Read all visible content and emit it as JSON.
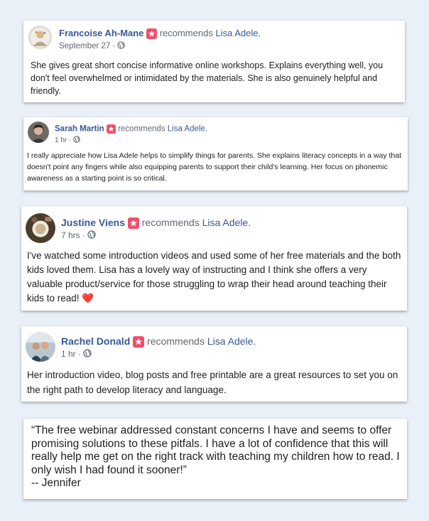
{
  "reviews": [
    {
      "name": "Francoise Ah-Mane",
      "recommends": "recommends",
      "page": "Lisa Adele.",
      "time": "September 27 ·",
      "text": "She gives great short concise informative online workshops. Explains everything well, you don't feel overwhelmed or intimidated by the materials. She is also genuinely helpful and friendly."
    },
    {
      "name": "Sarah Martin",
      "recommends": "recommends",
      "page": "Lisa Adele.",
      "time": "1 hr ·",
      "text": "I really appreciate how Lisa Adele helps to simplify things for parents. She explains literacy concepts in a way that doesn't point any fingers while also equipping parents to support their child's learning. Her focus on phonemic awareness as a starting point is so critical."
    },
    {
      "name": "Justine Viens",
      "recommends": "recommends",
      "page": "Lisa Adele.",
      "time": "7 hrs ·",
      "text": "I've watched some introduction videos and used some of her free materials and the both kids loved them. Lisa has a lovely way of instructing and I think she offers a very valuable product/service for those struggling to wrap their head around teaching their kids to read!",
      "emoji": "❤️"
    },
    {
      "name": "Rachel Donald",
      "recommends": "recommends",
      "page": "Lisa Adele.",
      "time": "1 hr ·",
      "text": "Her introduction video, blog posts and free printable are a great resources to set you on the right path to develop literacy and language."
    }
  ],
  "testimonial": {
    "quote": "“The free webinar addressed constant concerns I have and seems to offer promising solutions to these pitfals. I have a lot of confidence that this will really help me get on the right track with teaching my children how to read. I only wish I had found it sooner!”",
    "author": "-- Jennifer"
  },
  "icons": {
    "recommend_badge": "recommend-star-icon",
    "privacy": "globe-icon"
  },
  "colors": {
    "name": "#385898",
    "badge": "#f04f6b",
    "meta": "#606770",
    "background": "#e9f0f8"
  }
}
